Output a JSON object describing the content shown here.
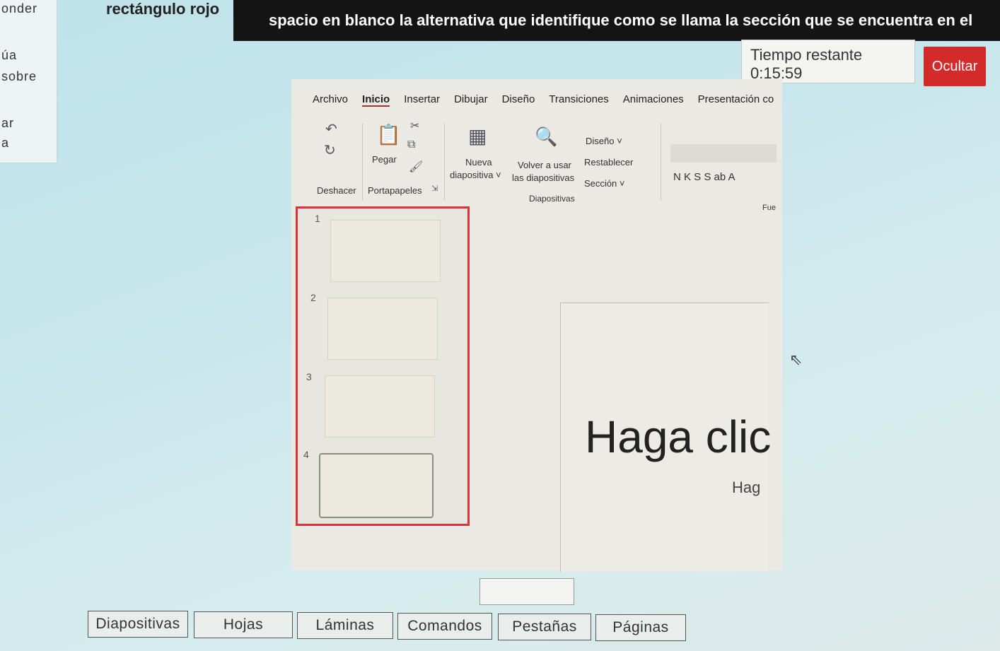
{
  "left_panel": {
    "fragments": [
      "onder",
      "úa",
      "sobre",
      "ar",
      "a"
    ]
  },
  "question": {
    "line1": "rectángulo rojo",
    "line2": "spacio en blanco la alternativa que identifique como se llama la sección que se encuentra en el área del"
  },
  "timer": {
    "label": "Tiempo restante 0:15:59"
  },
  "hide_button": {
    "label": "Ocultar"
  },
  "ppt": {
    "tabs": [
      "Archivo",
      "Inicio",
      "Insertar",
      "Dibujar",
      "Diseño",
      "Transiciones",
      "Animaciones",
      "Presentación co"
    ],
    "active_tab": "Inicio",
    "ribbon": {
      "undo_group": "Deshacer",
      "clipboard_group": "Portapapeles",
      "paste": "Pegar",
      "new_slide_1": "Nueva",
      "new_slide_2": "diapositiva ˅",
      "reuse_1": "Volver a usar",
      "reuse_2": "las diapositivas",
      "layout": "Diseño ˅",
      "reset": "Restablecer",
      "section": "Sección ˅",
      "slides_group": "Diapositivas",
      "font_group": "Fue",
      "format_letters": "N  K  S  S  ab  A"
    },
    "thumbnails": [
      "1",
      "2",
      "3",
      "4"
    ],
    "slide": {
      "title": "Haga clic",
      "subtitle": "Hag"
    }
  },
  "options": [
    "Diapositivas",
    "Hojas",
    "Láminas",
    "Comandos",
    "Pestañas",
    "Páginas"
  ]
}
